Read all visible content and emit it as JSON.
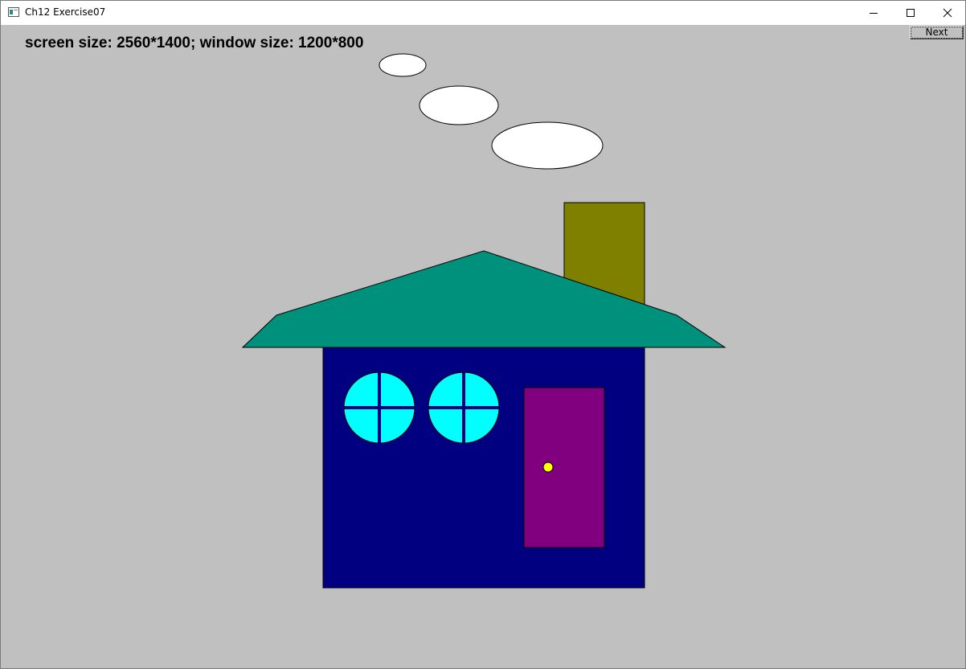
{
  "window": {
    "title": "Ch12 Exercise07",
    "minimize_icon": "minimize-icon",
    "maximize_icon": "maximize-icon",
    "close_icon": "close-icon"
  },
  "canvas": {
    "info_text": "screen size: 2560*1400; window size: 1200*800",
    "next_label": "Next"
  },
  "colors": {
    "background": "#c0c0c0",
    "roof": "#00917c",
    "chimney": "#808000",
    "house_body": "#000080",
    "window_glass": "#00ffff",
    "door": "#800080",
    "door_knob": "#ffff00",
    "smoke": "#ffffff"
  }
}
